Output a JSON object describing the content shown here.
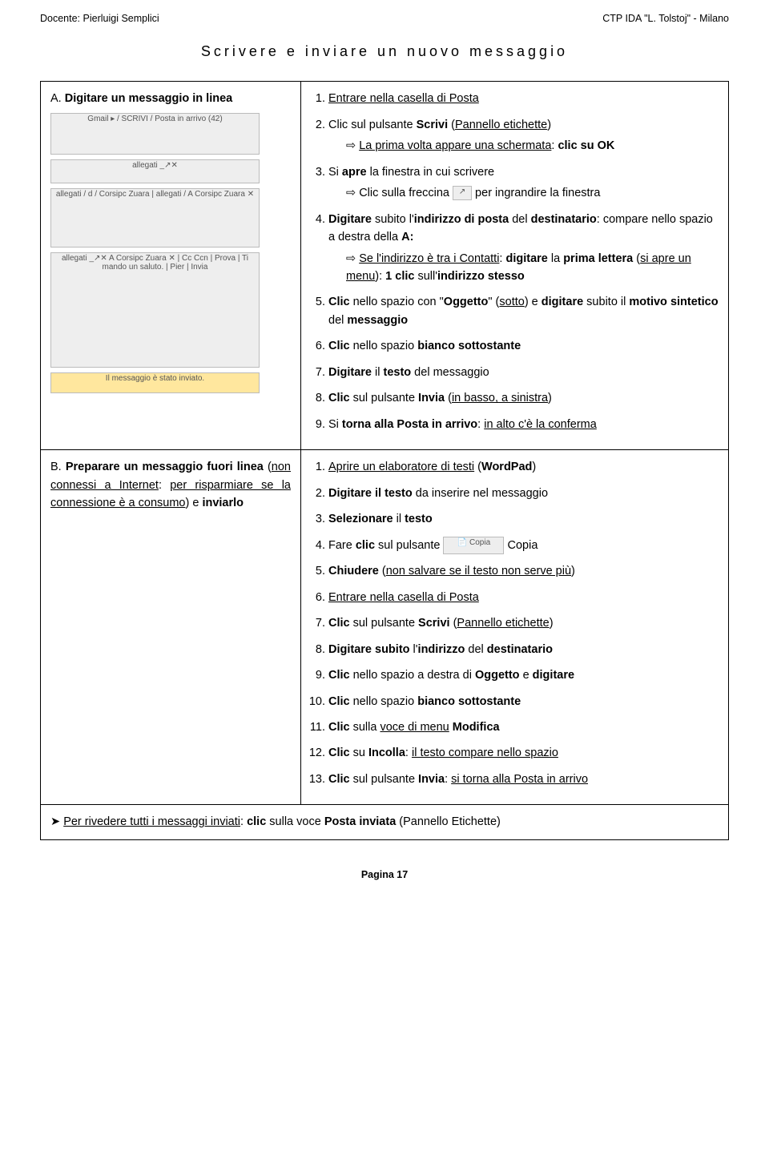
{
  "header": {
    "left": "Docente: Pierluigi Semplici",
    "right": "CTP IDA \"L. Tolstoj\" - Milano"
  },
  "title": "Scrivere e inviare un nuovo messaggio",
  "sectionA": {
    "heading_prefix": "A. ",
    "heading_bold": "Digitare un messaggio in linea",
    "steps": {
      "s1": {
        "num": "1.",
        "body": "Entrare nella casella di Posta"
      },
      "s2": {
        "num": "2.",
        "pre": "Clic sul pulsante ",
        "b1": "Scrivi",
        "mid": " (",
        "u1": "Pannello etichette",
        "post": ")",
        "sub_u": "La prima volta appare una schermata",
        "sub_after": ": ",
        "sub_b": "clic su OK"
      },
      "s3": {
        "num": "3.",
        "pre": "Si ",
        "b1": "apre",
        "mid": " la finestra in cui scrivere",
        "sub_pre": "Clic sulla freccina ",
        "sub_post": " per ingrandire la finestra"
      },
      "s4": {
        "num": "4.",
        "b1": "Digitare",
        "mid1": " subito l'",
        "b2": "indirizzo di posta",
        "mid2": " del ",
        "b3": "destinatario",
        "mid3": ": compare nello spazio a destra della ",
        "b4": "A:",
        "sub_u": "Se l'indirizzo è tra i Contatti",
        "sub_mid": ": ",
        "sub_b1": "digitare",
        "sub_mid2": " la ",
        "sub_b2": "prima lettera",
        "sub_mid3": " (",
        "sub_u2": "si apre un menu",
        "sub_mid4": "): ",
        "sub_b3": "1 clic",
        "sub_mid5": " sull'",
        "sub_b4": "indirizzo stesso"
      },
      "s5": {
        "num": "5.",
        "b1": "Clic",
        "mid1": " nello spazio con \"",
        "b2": "Oggetto",
        "mid2": "\" (",
        "u1": "sotto",
        "mid3": ") e ",
        "b3": "digitare",
        "mid4": " subito il ",
        "b4": "motivo sintetico",
        "mid5": " del ",
        "b5": "messaggio"
      },
      "s6": {
        "num": "6.",
        "b1": "Clic",
        "mid": " nello spazio ",
        "b2": "bianco sottostante"
      },
      "s7": {
        "num": "7.",
        "b1": "Digitare",
        "mid": " il ",
        "b2": "testo",
        "post": " del messaggio"
      },
      "s8": {
        "num": "8.",
        "b1": "Clic",
        "mid": " sul pulsante ",
        "b2": "Invia",
        "post_open": " (",
        "u1": "in basso, a sinistra",
        "post_close": ")"
      },
      "s9": {
        "num": "9.",
        "pre": "Si ",
        "b1": "torna alla Posta in arrivo",
        "mid": ": ",
        "u1": "in alto c'è la conferma"
      }
    }
  },
  "sectionB": {
    "heading_prefix": "B. ",
    "heading_b1": "Preparare un messaggio fuori linea",
    "heading_open": " (",
    "heading_u1": "non connessi a Internet",
    "heading_mid": ": ",
    "heading_u2": "per risparmiare se la connessione è a consumo",
    "heading_close": ") e ",
    "heading_b2": "inviarlo",
    "steps": {
      "s1": {
        "num": "1.",
        "u1": "Aprire un elaboratore di testi",
        "open": " (",
        "b1": "WordPad",
        "close": ")"
      },
      "s2": {
        "num": "2.",
        "b1": "Digitare il testo",
        "post": " da inserire nel messaggio"
      },
      "s3": {
        "num": "3.",
        "b1": "Selezionare",
        "post": " il ",
        "b2": "testo"
      },
      "s4": {
        "num": "4.",
        "pre": "Fare ",
        "b1": "clic",
        "mid": " sul pulsante ",
        "post": " Copia"
      },
      "s5": {
        "num": "5.",
        "b1": "Chiudere",
        "open": " (",
        "u1": "non salvare se il testo non serve più",
        "close": ")"
      },
      "s6": {
        "num": "6.",
        "u1": "Entrare nella casella di Posta"
      },
      "s7": {
        "num": "7.",
        "b1": "Clic",
        "mid": " sul pulsante ",
        "b2": "Scrivi",
        "open": " (",
        "u1": "Pannello etichette",
        "close": ")"
      },
      "s8": {
        "num": "8.",
        "b1": "Digitare subito",
        "mid": " l'",
        "b2": "indirizzo",
        "mid2": " del ",
        "b3": "destinatario"
      },
      "s9": {
        "num": "9.",
        "b1": "Clic",
        "mid": " nello spazio a destra di ",
        "b2": "Oggetto",
        "mid2": " e ",
        "b3": "digitare"
      },
      "s10": {
        "num": "10.",
        "b1": "Clic",
        "mid": " nello spazio ",
        "b2": "bianco sottostante"
      },
      "s11": {
        "num": "11.",
        "b1": "Clic",
        "mid": " sulla ",
        "u1": "voce di menu",
        "mid2": " ",
        "b2": "Modifica"
      },
      "s12": {
        "num": "12.",
        "b1": "Clic",
        "mid": " su ",
        "b2": "Incolla",
        "mid2": ": ",
        "u1": "il testo compare nello spazio"
      },
      "s13": {
        "num": "13.",
        "b1": "Clic",
        "mid": " sul pulsante ",
        "b2": "Invia",
        "mid2": ": ",
        "u1": "si torna alla Posta in arrivo"
      }
    }
  },
  "footer": {
    "u1": "Per rivedere tutti i messaggi inviati",
    "mid": ": ",
    "b1": "clic",
    "mid2": " sulla voce ",
    "b2": "Posta inviata",
    "post_open": " (",
    "post_text": "Pannello Etichette",
    "post_close": ")"
  },
  "pagenum": "Pagina 17",
  "icons": {
    "expand_icon": "↗",
    "copia_label": "📄 Copia"
  },
  "screenshots": {
    "a1": "Gmail ▸ / SCRIVI / Posta in arrivo (42)",
    "a2": "allegati  _↗✕",
    "a3": "allegati / d / Corsipc Zuara  |  allegati / A Corsipc Zuara ✕",
    "a4": "allegati  _↗✕  A Corsipc Zuara ✕ |  Cc Ccn  | Prova | Ti mando un saluto. | Pier | Invia",
    "a5": "Il messaggio è stato inviato."
  }
}
